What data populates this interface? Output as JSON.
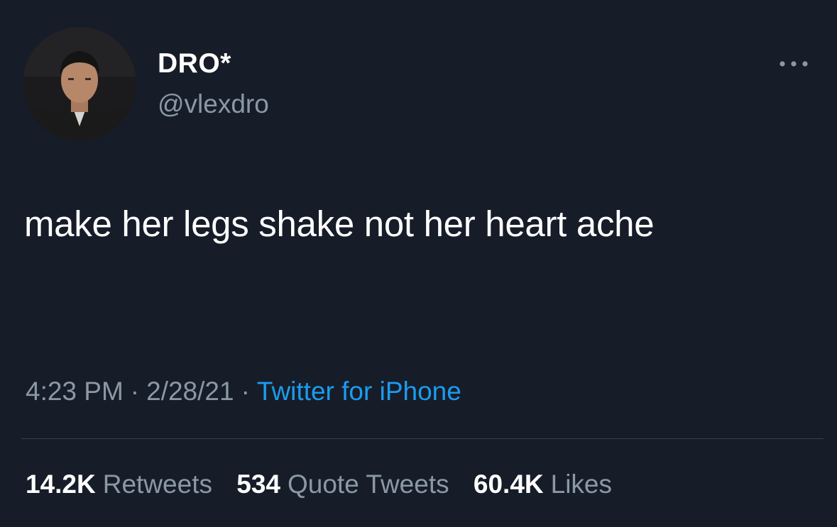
{
  "tweet": {
    "author": {
      "display_name": "DRO*",
      "handle": "@vlexdro",
      "avatar_icon": "profile-photo"
    },
    "more_icon": "more-horizontal-icon",
    "text": "make her legs shake not her heart ache",
    "meta": {
      "time": "4:23 PM",
      "date": "2/28/21",
      "separator": "·",
      "source": "Twitter for iPhone"
    },
    "stats": {
      "retweets": {
        "count": "14.2K",
        "label": "Retweets"
      },
      "quote_tweets": {
        "count": "534",
        "label": "Quote Tweets"
      },
      "likes": {
        "count": "60.4K",
        "label": "Likes"
      }
    }
  },
  "colors": {
    "background": "#161d28",
    "primary_text": "#ffffff",
    "secondary_text": "#8b98a5",
    "link": "#1d9bf0",
    "divider": "#38444d"
  }
}
